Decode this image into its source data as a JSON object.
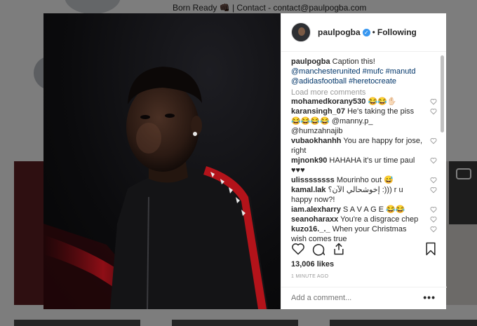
{
  "background": {
    "bio": "Born Ready 👊🏿 | Contact - contact@paulpogba.com"
  },
  "post": {
    "username": "paulpogba",
    "verified": true,
    "follow_separator": "•",
    "follow_label": "Following",
    "caption_user": "paulpogba",
    "caption_text": "Caption this!",
    "caption_tags": "@manchesterunited #mufc #manutd @adidasfootball #heretocreate",
    "load_more": "Load more comments",
    "comments": [
      {
        "user": "mohamedkorany530",
        "text": "😂😂✋🏻"
      },
      {
        "user": "karansingh_07",
        "text": "He's taking the piss 😂😂😂😂 @manny.p_ @humzahnajib"
      },
      {
        "user": "vubaokhanhh",
        "text": "You are happy for jose, right"
      },
      {
        "user": "mjnonk90",
        "text": "HAHAHA it's ur time paul ♥♥♥"
      },
      {
        "user": "ulissssssss",
        "text": "Mourinho out 😅"
      },
      {
        "user": "kamal.lak",
        "text": "إخوشحالي الآن؟ :))) r u happy now?!"
      },
      {
        "user": "iam.alexharry",
        "text": "S A V A G E 😂😂"
      },
      {
        "user": "seanoharaxx",
        "text": "You're a disgrace chep"
      },
      {
        "user": "kuzo16._._",
        "text": "When your Christmas wish comes true"
      }
    ],
    "likes": "13,006 likes",
    "time": "1 MINUTE AGO",
    "add_comment_placeholder": "Add a comment...",
    "more_label": "•••"
  },
  "icons": {
    "verified": "verified-badge-icon",
    "heart": "heart-icon",
    "comment": "comment-icon",
    "share": "share-icon",
    "bookmark": "bookmark-icon"
  },
  "colors": {
    "link": "#003569",
    "verified": "#3897f0",
    "muted": "#999999",
    "text": "#262626"
  }
}
